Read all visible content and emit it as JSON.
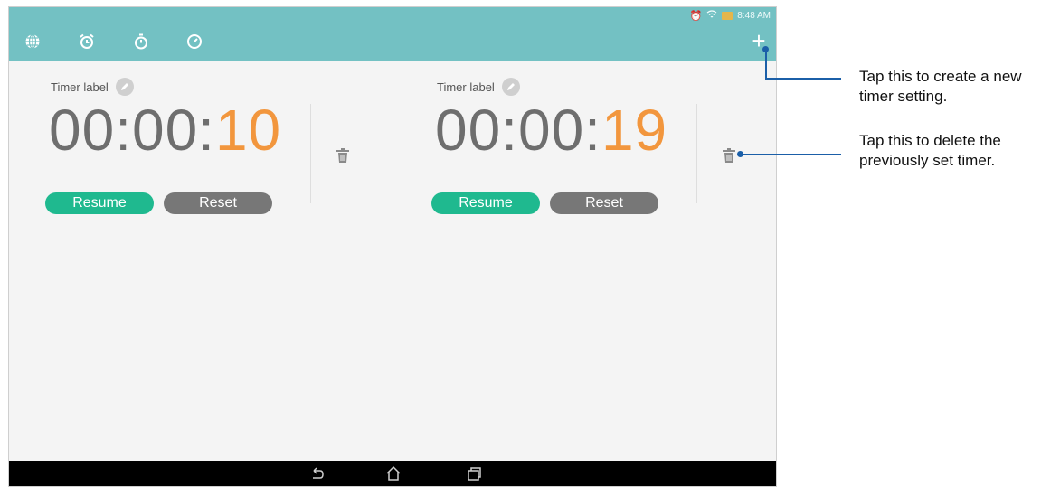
{
  "status_bar": {
    "time": "8:48 AM",
    "icons": [
      "alarm-icon",
      "wifi-icon",
      "battery-icon"
    ]
  },
  "app_bar": {
    "tabs": [
      "world-clock-icon",
      "alarm-icon",
      "stopwatch-icon",
      "timer-icon"
    ],
    "add_icon": "plus-icon",
    "add_label": "+"
  },
  "timers": [
    {
      "label": "Timer label",
      "digits_main": "00:00:",
      "digits_sec": "10",
      "resume_label": "Resume",
      "reset_label": "Reset"
    },
    {
      "label": "Timer label",
      "digits_main": "00:00:",
      "digits_sec": "19",
      "resume_label": "Resume",
      "reset_label": "Reset"
    }
  ],
  "nav_bar": {
    "icons": [
      "back-icon",
      "home-icon",
      "recent-apps-icon"
    ]
  },
  "callouts": {
    "add_line1": "Tap this to create a new",
    "add_line2": "timer setting.",
    "delete_line1": "Tap this to delete the",
    "delete_line2": "previously set timer."
  },
  "colors": {
    "app_bar": "#73c1c3",
    "resume": "#1fb98f",
    "reset": "#777777",
    "seconds": "#f2963d",
    "leader": "#1b5fa8"
  }
}
